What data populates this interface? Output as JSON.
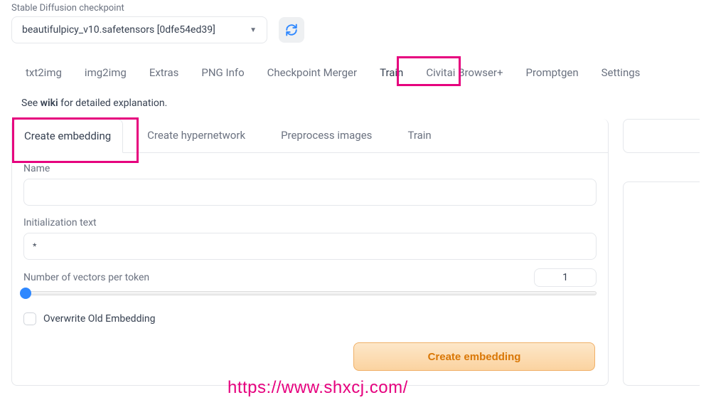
{
  "header": {
    "checkpoint_label": "Stable Diffusion checkpoint",
    "checkpoint_value": "beautifulpicy_v10.safetensors [0dfe54ed39]"
  },
  "main_tabs": [
    "txt2img",
    "img2img",
    "Extras",
    "PNG Info",
    "Checkpoint Merger",
    "Train",
    "Civitai Browser+",
    "Promptgen",
    "Settings"
  ],
  "main_tab_active": "Train",
  "wiki_note": {
    "prefix": "See ",
    "bold": "wiki",
    "suffix": " for detailed explanation."
  },
  "sub_tabs": [
    "Create embedding",
    "Create hypernetwork",
    "Preprocess images",
    "Train"
  ],
  "sub_tab_active": "Create embedding",
  "form": {
    "name_label": "Name",
    "name_value": "",
    "init_label": "Initialization text",
    "init_value": "*",
    "vectors_label": "Number of vectors per token",
    "vectors_value": "1",
    "overwrite_label": "Overwrite Old Embedding",
    "create_button": "Create embedding"
  },
  "watermark": "https://www.shxcj.com/"
}
